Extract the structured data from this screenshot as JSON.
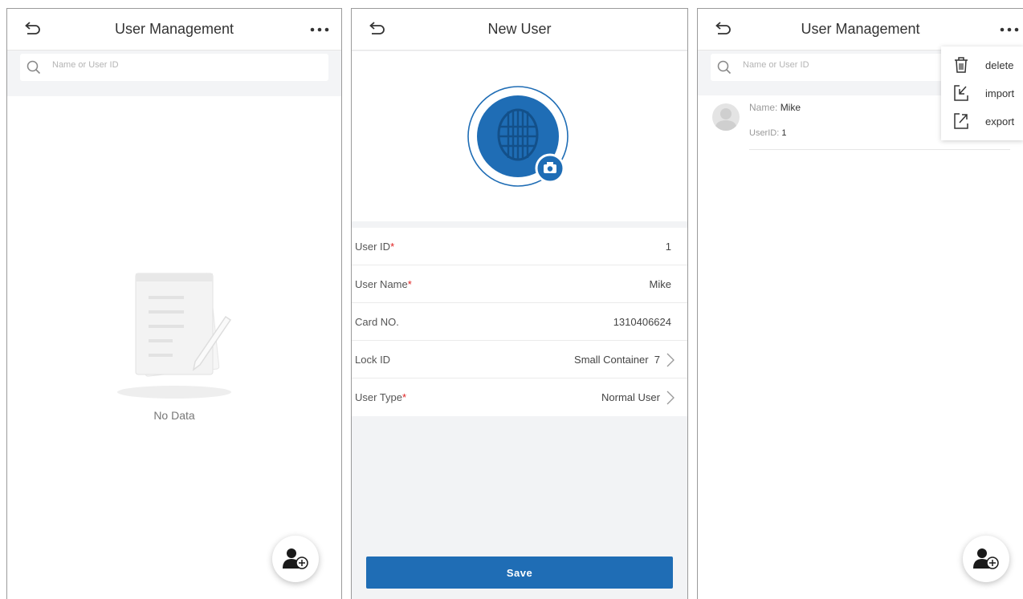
{
  "screen1": {
    "title": "User Management",
    "search_placeholder": "Name or User ID",
    "empty_text": "No Data"
  },
  "screen2": {
    "title": "New User",
    "fields": [
      {
        "label": "User ID",
        "required": "*",
        "value": "1"
      },
      {
        "label": "User Name",
        "required": "*",
        "value": "Mike"
      },
      {
        "label": "Card NO.",
        "required": "",
        "value": "1310406624"
      },
      {
        "label": "Lock ID",
        "required": "",
        "value": "Small Container  7"
      },
      {
        "label": "User Type",
        "required": "*",
        "value": "Normal User"
      }
    ],
    "save_label": "Save"
  },
  "screen3": {
    "title": "User Management",
    "search_placeholder": "Name or User ID",
    "user": {
      "name_label": "Name:",
      "name": "Mike",
      "id_label": "UserID:",
      "id": "1"
    },
    "menu": [
      {
        "label": "delete",
        "icon": "trash-icon"
      },
      {
        "label": "import",
        "icon": "import-icon"
      },
      {
        "label": "export",
        "icon": "export-icon"
      }
    ]
  },
  "colors": {
    "accent": "#1f6db5",
    "required": "#e02020",
    "background_gray": "#f2f3f5"
  }
}
